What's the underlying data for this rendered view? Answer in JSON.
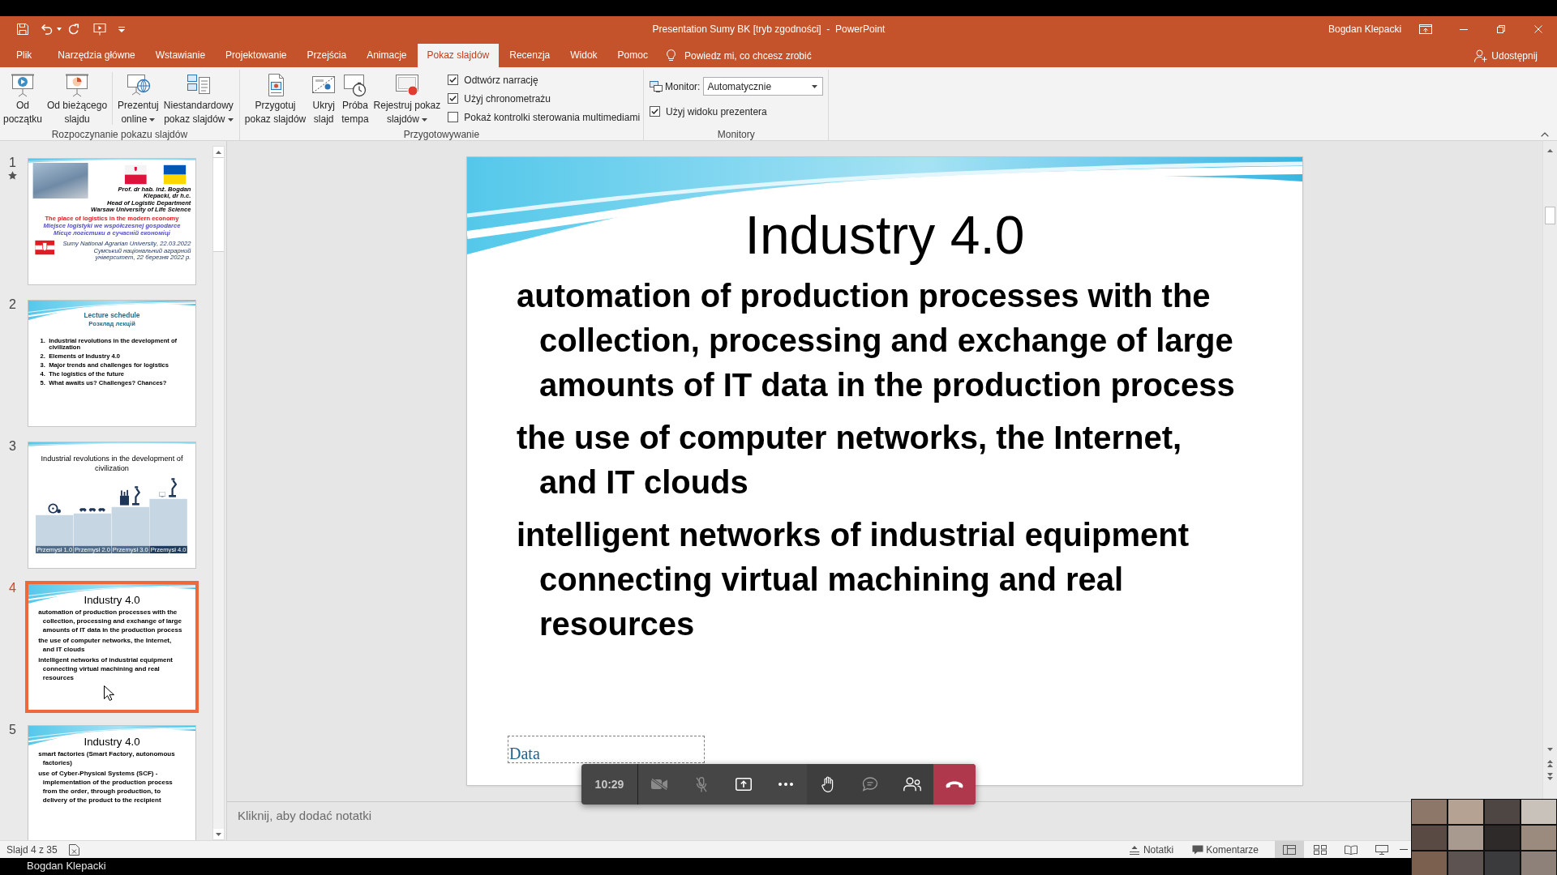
{
  "title_bar": {
    "title": "Presentation Sumy BK [tryb zgodności]  -  PowerPoint",
    "user": "Bogdan Klepacki"
  },
  "tabs": [
    {
      "label": "Plik",
      "selected": false
    },
    {
      "label": "Narzędzia główne",
      "selected": false
    },
    {
      "label": "Wstawianie",
      "selected": false
    },
    {
      "label": "Projektowanie",
      "selected": false
    },
    {
      "label": "Przejścia",
      "selected": false
    },
    {
      "label": "Animacje",
      "selected": false
    },
    {
      "label": "Pokaz slajdów",
      "selected": true
    },
    {
      "label": "Recenzja",
      "selected": false
    },
    {
      "label": "Widok",
      "selected": false
    },
    {
      "label": "Pomoc",
      "selected": false
    }
  ],
  "tell_me": {
    "label": "Powiedz mi, co chcesz zrobić"
  },
  "share": {
    "label": "Udostępnij"
  },
  "ribbon": {
    "groups": [
      {
        "label": "Rozpoczynanie pokazu slajdów",
        "items": [
          {
            "kind": "from_beginning",
            "label": "Od\npoczątku",
            "has_menu": false
          },
          {
            "kind": "from_current",
            "label": "Od bieżącego\nslajdu",
            "has_menu": false
          },
          {
            "kind": "separator"
          },
          {
            "kind": "present_online",
            "label": "Prezentuj\nonline",
            "has_menu": true
          },
          {
            "kind": "custom_show",
            "label": "Niestandardowy\npokaz slajdów",
            "has_menu": true
          }
        ]
      },
      {
        "label": "Przygotowywanie",
        "items": [
          {
            "kind": "setup",
            "label": "Przygotuj\npokaz slajdów",
            "has_menu": false
          },
          {
            "kind": "hide",
            "label": "Ukryj\nslajd",
            "has_menu": false
          },
          {
            "kind": "rehearse",
            "label": "Próba\ntempa",
            "has_menu": false
          },
          {
            "kind": "record",
            "label": "Rejestruj pokaz\nslajdów",
            "has_menu": true
          },
          {
            "kind": "options",
            "rows": [
              {
                "kind": "checkbox",
                "label": "Odtwórz narrację",
                "checked": true
              },
              {
                "kind": "checkbox",
                "label": "Użyj chronometrażu",
                "checked": true
              },
              {
                "kind": "checkbox",
                "label": "Pokaż kontrolki sterowania multimediami",
                "checked": false
              }
            ]
          }
        ]
      },
      {
        "label": "Monitory",
        "items": [
          {
            "kind": "options",
            "rows": [
              {
                "kind": "select",
                "label": "Monitor:",
                "value": "Automatycznie"
              },
              {
                "kind": "checkbox",
                "label": "Użyj widoku prezentera",
                "checked": true
              }
            ]
          }
        ]
      }
    ]
  },
  "slides": [
    {
      "number": "1",
      "selected": false,
      "animated": true,
      "kind": "title",
      "author_lines": [
        "Prof. dr hab. inż. Bogdan Klepacki, dr h.c.",
        "Head of Logistic Department",
        "Warsaw University of Life Science"
      ],
      "title": "The place of logistics in the modern economy",
      "subtitles": [
        "Miejsce logistyki we współczesnej gospodarce",
        "Місце логістики в сучасній економіці"
      ],
      "venue_lines": [
        "Sumy National Agrarian University, 22.03.2022",
        "Сумський національний аграрний університет, 22 березня 2022 р."
      ]
    },
    {
      "number": "2",
      "selected": false,
      "animated": false,
      "kind": "list",
      "title": "Lecture schedule",
      "subtitle": "Розклад лекцій",
      "items": [
        {
          "number": "1.",
          "text": "Industrial revolutions in the development of civilization"
        },
        {
          "number": "2.",
          "text": "Elements of Industry 4.0"
        },
        {
          "number": "3.",
          "text": "Major trends and challenges for logistics"
        },
        {
          "number": "4.",
          "text": "The logistics of the future"
        },
        {
          "number": "5.",
          "text": "What awaits us? Challenges? Chances?"
        }
      ]
    },
    {
      "number": "3",
      "selected": false,
      "animated": false,
      "kind": "infographic",
      "title": "Industrial revolutions in the development of civilization",
      "panels": [
        {
          "kind": "wheel",
          "label": "Przemysł 1.0"
        },
        {
          "kind": "cars",
          "label": "Przemysł 2.0"
        },
        {
          "kind": "factory",
          "label": "Przemysł 3.0"
        },
        {
          "kind": "robots",
          "label": "Przemysł 4.0"
        }
      ]
    },
    {
      "number": "4",
      "selected": true,
      "animated": false,
      "kind": "bullets",
      "title": "Industry 4.0",
      "bullets": [
        "automation of production processes with the collection, processing and exchange of large amounts of IT data in the production process",
        "the use of computer networks, the Internet, and IT clouds",
        "intelligent networks of industrial equipment connecting virtual machining and real resources"
      ]
    },
    {
      "number": "5",
      "selected": false,
      "animated": false,
      "kind": "bullets",
      "title": "Industry 4.0",
      "bullets": [
        "smart factories (Smart Factory, autonomous factories)",
        "use of Cyber-Physical Systems (SCF) - implementation of the production process from the order, through production, to delivery of the product to the recipient"
      ]
    }
  ],
  "editor": {
    "slide": {
      "kind": "bullets",
      "title": "Industry 4.0",
      "bullets": [
        "automation of production processes with the collection, processing and exchange of large amounts of IT data in the production process",
        "the use of computer networks, the Internet, and IT clouds",
        "intelligent networks of industrial equipment connecting virtual machining and real resources"
      ],
      "date_field": "Data"
    },
    "notes": {
      "placeholder": "Kliknij, aby dodać notatki"
    }
  },
  "status_bar": {
    "slide_counter": "Slajd 4 z 35",
    "notes_button": "Notatki",
    "comments_button": "Komentarze",
    "views": [
      {
        "kind": "normal",
        "selected": true
      },
      {
        "kind": "sorter",
        "selected": false
      },
      {
        "kind": "reading",
        "selected": false
      },
      {
        "kind": "slideshow",
        "selected": false
      }
    ]
  },
  "call_controls": {
    "time": "10:29",
    "buttons": [
      {
        "kind": "camera",
        "on": false
      },
      {
        "kind": "microphone",
        "on": false
      },
      {
        "kind": "share"
      },
      {
        "kind": "more"
      },
      {
        "kind": "raise_hand"
      },
      {
        "kind": "chat"
      },
      {
        "kind": "participants"
      },
      {
        "kind": "hang_up"
      }
    ]
  },
  "presenter_label": "Bogdan Klepacki"
}
